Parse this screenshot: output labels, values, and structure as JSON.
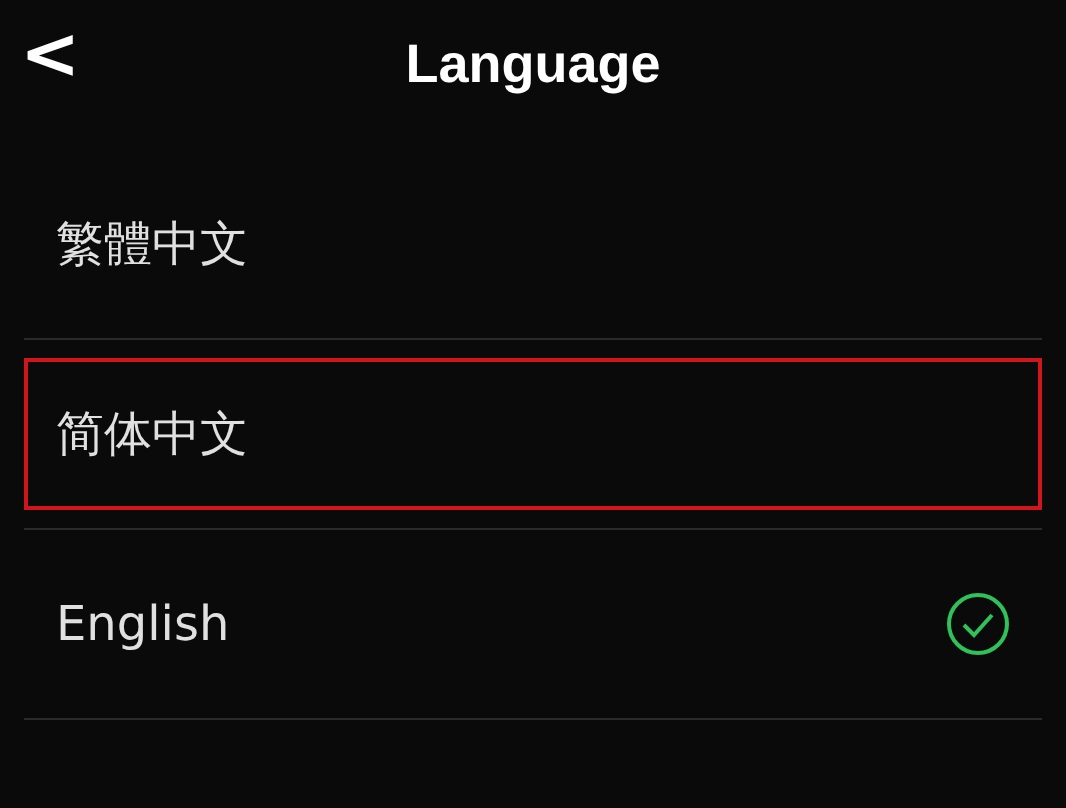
{
  "header": {
    "back_icon": "<",
    "title": "Language"
  },
  "languages": [
    {
      "label": "繁體中文",
      "selected": false,
      "highlighted": false
    },
    {
      "label": "简体中文",
      "selected": false,
      "highlighted": true
    },
    {
      "label": "English",
      "selected": true,
      "highlighted": false
    }
  ]
}
